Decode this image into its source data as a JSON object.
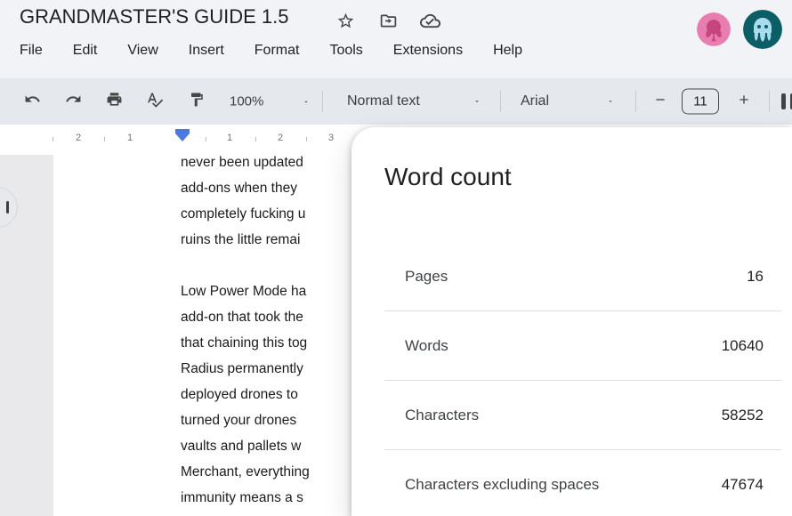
{
  "header": {
    "title": "GRANDMASTER'S GUIDE 1.5",
    "menus": [
      "File",
      "Edit",
      "View",
      "Insert",
      "Format",
      "Tools",
      "Extensions",
      "Help"
    ],
    "icons": [
      "star-icon",
      "move-to-folder-icon",
      "cloud-check-icon"
    ]
  },
  "toolbar": {
    "zoom": "100%",
    "style": "Normal text",
    "font": "Arial",
    "font_size": "11",
    "icons": [
      "undo-icon",
      "redo-icon",
      "print-icon",
      "spellcheck-icon",
      "paint-format-icon",
      "minus-icon",
      "plus-icon"
    ]
  },
  "ruler": {
    "numbers": [
      "2",
      "1",
      "1",
      "2",
      "3"
    ]
  },
  "document": {
    "lines": [
      "never been updated",
      "add-ons when they",
      "completely fucking u",
      "ruins the little remai",
      "",
      "Low Power Mode ha",
      "add-on that took the",
      "that chaining this tog",
      "Radius permanently",
      "deployed drones to",
      "turned your drones",
      "vaults and pallets w",
      "Merchant, everything",
      "immunity means a s"
    ]
  },
  "dialog": {
    "title": "Word count",
    "rows": [
      {
        "label": "Pages",
        "value": "16"
      },
      {
        "label": "Words",
        "value": "10640"
      },
      {
        "label": "Characters",
        "value": "58252"
      },
      {
        "label": "Characters excluding spaces",
        "value": "47674"
      }
    ]
  },
  "colors": {
    "accent_blue": "#4b79e0",
    "avatar_pink": "#e87daf",
    "avatar_teal": "#0b5e66",
    "toolbar_bg": "#e5e8ec",
    "header_bg": "#f1f3f6"
  }
}
